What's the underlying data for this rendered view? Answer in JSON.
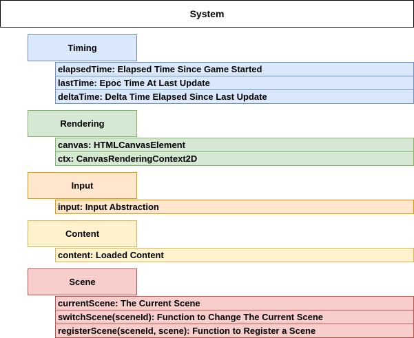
{
  "system": {
    "title": "System"
  },
  "groups": [
    {
      "name": "Timing",
      "fill": "#dae8fc",
      "stroke": "#6c8ebf",
      "fields": [
        "elapsedTime: Elapsed Time Since Game Started",
        "lastTime: Epoc Time At Last Update",
        "deltaTime: Delta Time Elapsed Since Last Update"
      ]
    },
    {
      "name": "Rendering",
      "fill": "#d5e8d4",
      "stroke": "#82b366",
      "fields": [
        "canvas: HTMLCanvasElement",
        "ctx: CanvasRenderingContext2D"
      ]
    },
    {
      "name": "Input",
      "fill": "#ffe6cc",
      "stroke": "#d79b00",
      "fields": [
        "input: Input Abstraction"
      ]
    },
    {
      "name": "Content",
      "fill": "#fff2cc",
      "stroke": "#d6b656",
      "fields": [
        "content: Loaded Content"
      ]
    },
    {
      "name": "Scene",
      "fill": "#f8cecc",
      "stroke": "#b85450",
      "fields": [
        "currentScene: The Current Scene",
        "switchScene(sceneId): Function to Change The Current Scene",
        "registerScene(sceneId, scene): Function to Register a Scene"
      ]
    }
  ]
}
